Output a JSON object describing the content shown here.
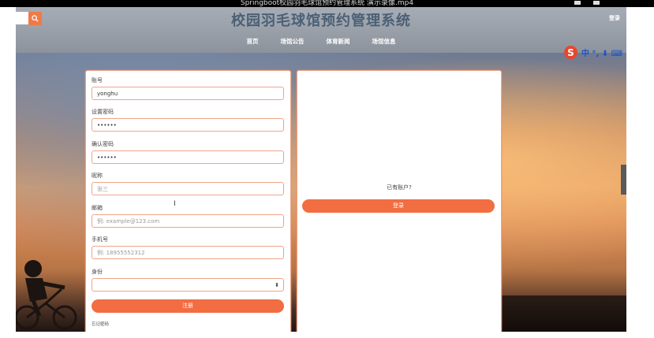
{
  "video": {
    "title": "Springboot校园羽毛球馆预约管理系统 演示录像.mp4"
  },
  "header": {
    "title": "校园羽毛球馆预约管理系统",
    "login": "登录",
    "search_icon": "search-icon"
  },
  "nav": {
    "items": [
      "首页",
      "场馆公告",
      "体育新闻",
      "场馆信息"
    ]
  },
  "ime": {
    "logo": "S",
    "text": "中 °, ⬇ ⌨"
  },
  "form": {
    "account": {
      "label": "账号",
      "value": "yonghu"
    },
    "password": {
      "label": "设置密码",
      "value": "••••••"
    },
    "confirm": {
      "label": "确认密码",
      "value": "••••••"
    },
    "nickname": {
      "label": "昵称",
      "placeholder": "张三"
    },
    "email": {
      "label": "邮箱",
      "placeholder": "例: example@123.com"
    },
    "phone": {
      "label": "手机号",
      "placeholder": "例: 18955552312"
    },
    "identity": {
      "label": "身份",
      "value": ""
    },
    "submit": "注册",
    "forgot": "忘记密码"
  },
  "side": {
    "has_account": "已有账户?",
    "login": "登录"
  },
  "colors": {
    "accent": "#f26d42",
    "title": "#4b6075"
  }
}
